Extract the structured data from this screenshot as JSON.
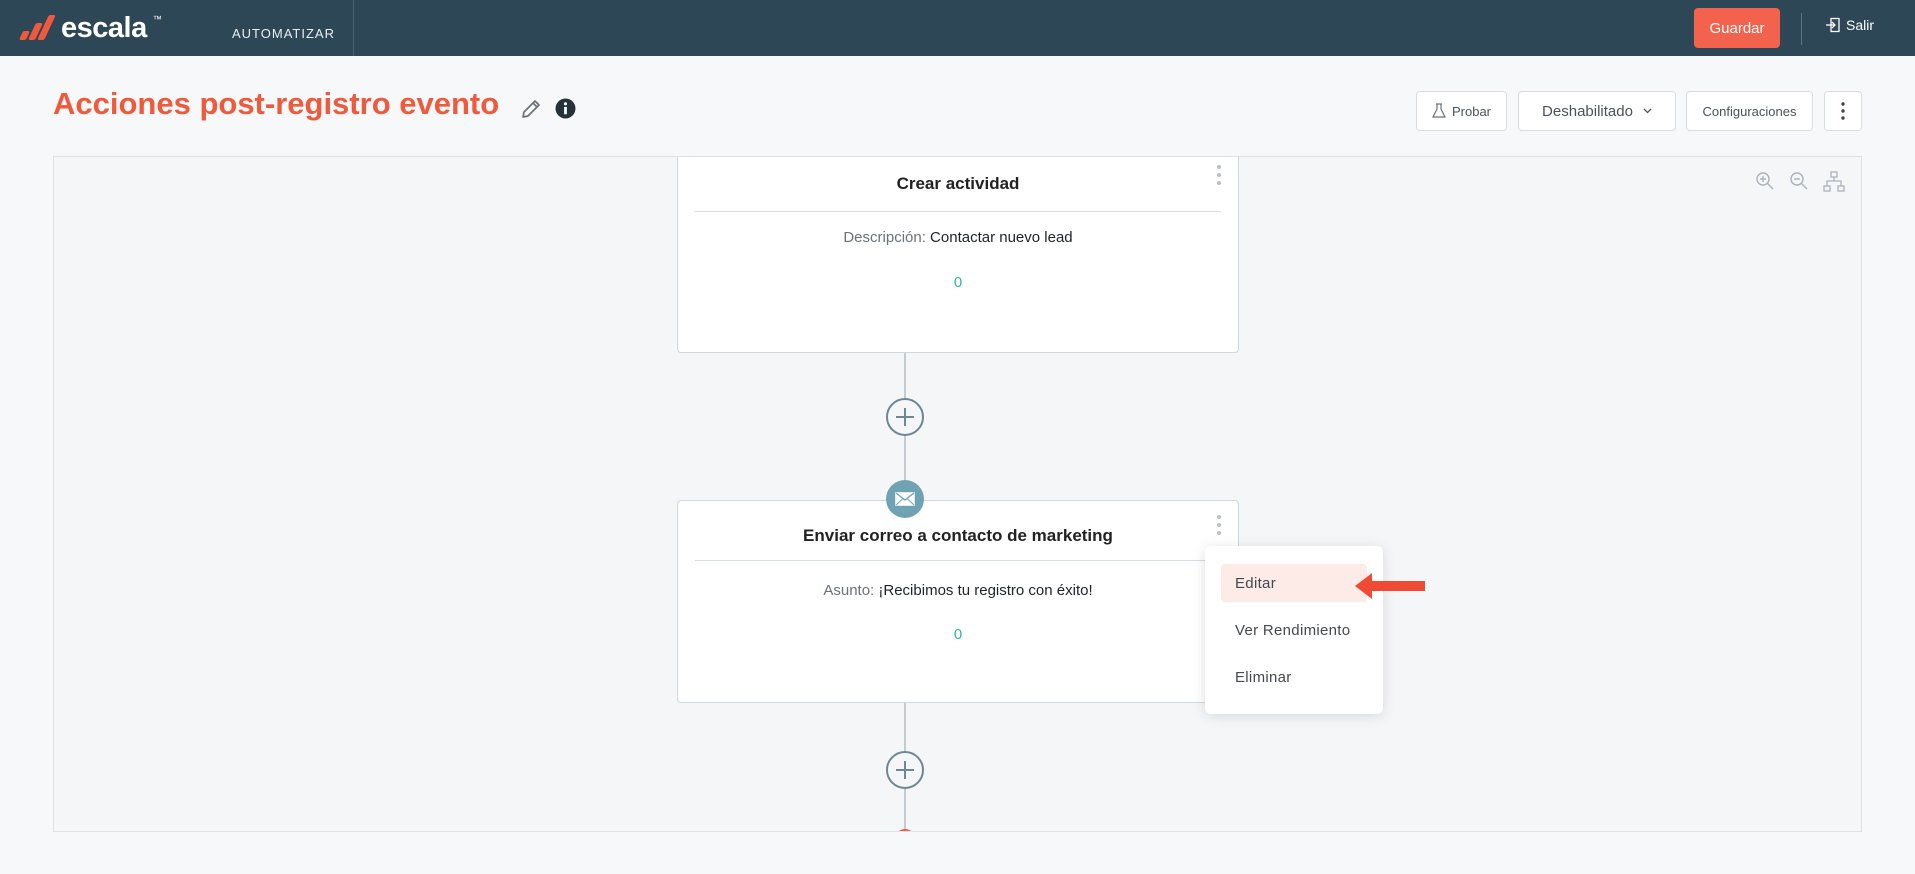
{
  "topbar": {
    "logo_text": "escala",
    "logo_tm": "™",
    "nav_label": "AUTOMATIZAR",
    "save_label": "Guardar",
    "logout_label": "Salir",
    "brand_color": "#f05a3c",
    "bar_color": "#2e4756"
  },
  "header": {
    "title": "Acciones post-registro evento",
    "edit_icon": "pencil-icon",
    "info_icon": "info-icon",
    "test_label": "Probar",
    "status_label": "Deshabilitado",
    "settings_label": "Configuraciones",
    "more_icon": "kebab-icon"
  },
  "canvas": {
    "zoom_in_icon": "zoom-in-icon",
    "zoom_out_icon": "zoom-out-icon",
    "layout_icon": "org-chart-icon",
    "nodes": [
      {
        "title": "Crear actividad",
        "field_label": "Descripción:",
        "field_value": "Contactar nuevo lead",
        "count": "0",
        "icon": "activity-icon"
      },
      {
        "title": "Enviar correo a contacto de marketing",
        "field_label": "Asunto:",
        "field_value": "¡Recibimos tu registro con éxito!",
        "count": "0",
        "icon": "envelope-icon"
      }
    ]
  },
  "context_menu": {
    "items": [
      "Editar",
      "Ver Rendimiento",
      "Eliminar"
    ],
    "highlighted": "Editar"
  }
}
